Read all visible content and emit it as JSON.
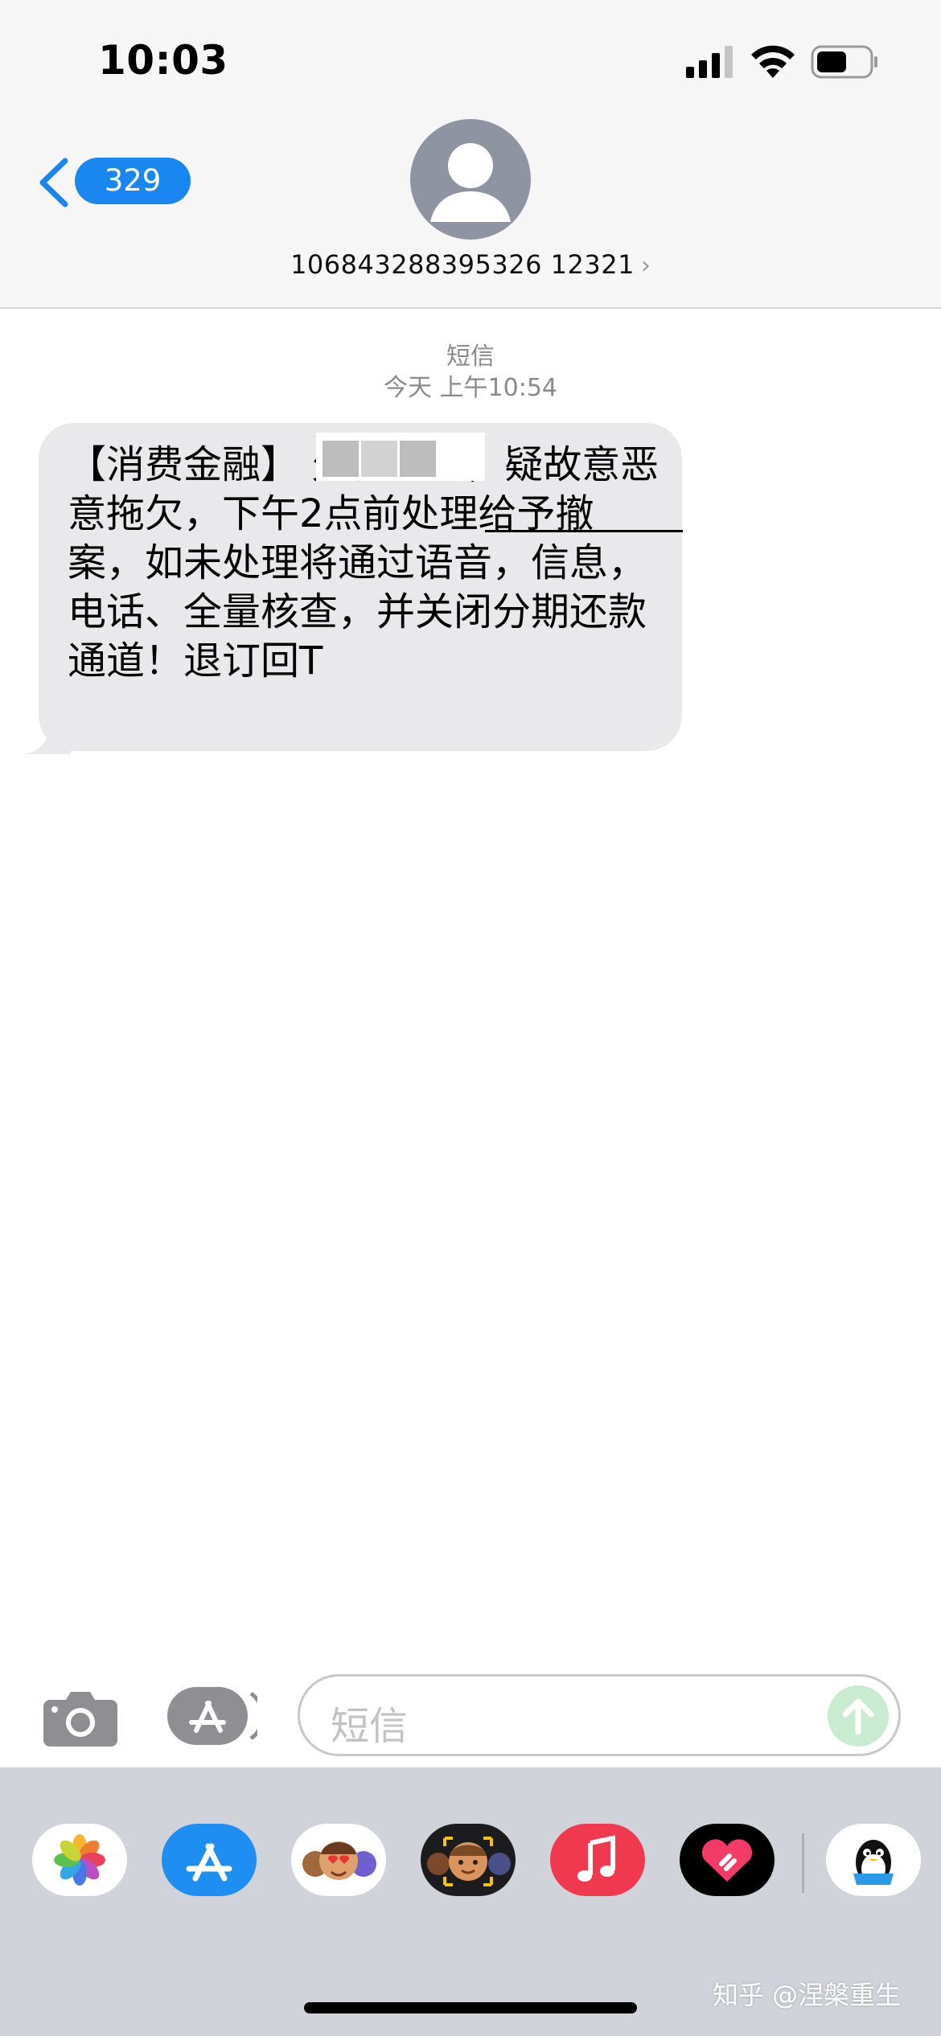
{
  "status_bar": {
    "time": "10:03",
    "icons": [
      "cellular-signal-icon",
      "wifi-icon",
      "battery-icon"
    ]
  },
  "header": {
    "back_badge": "329",
    "contact": "106843288395326 12321"
  },
  "conversation": {
    "label": "短信",
    "timestamp": "今天 上午10:54",
    "message": "【消费金融】              欠款逾期，疑故意恶意拖欠，下午2点前处理给予撤案，如未处理将通过语音，信息，电话、全量核查，并关闭分期还款通道！退订回T"
  },
  "input": {
    "placeholder": "短信"
  },
  "drawer": {
    "apps": [
      "photos-app",
      "app-store-app",
      "memoji-stickers-app",
      "animoji-app",
      "music-app",
      "digital-touch-app",
      "qq-app"
    ]
  },
  "watermark": "知乎 @涅槃重生",
  "colors": {
    "accent_blue": "#1a86f0",
    "bubble_gray": "#e9e9eb",
    "drawer_gray": "#d1d3db"
  }
}
